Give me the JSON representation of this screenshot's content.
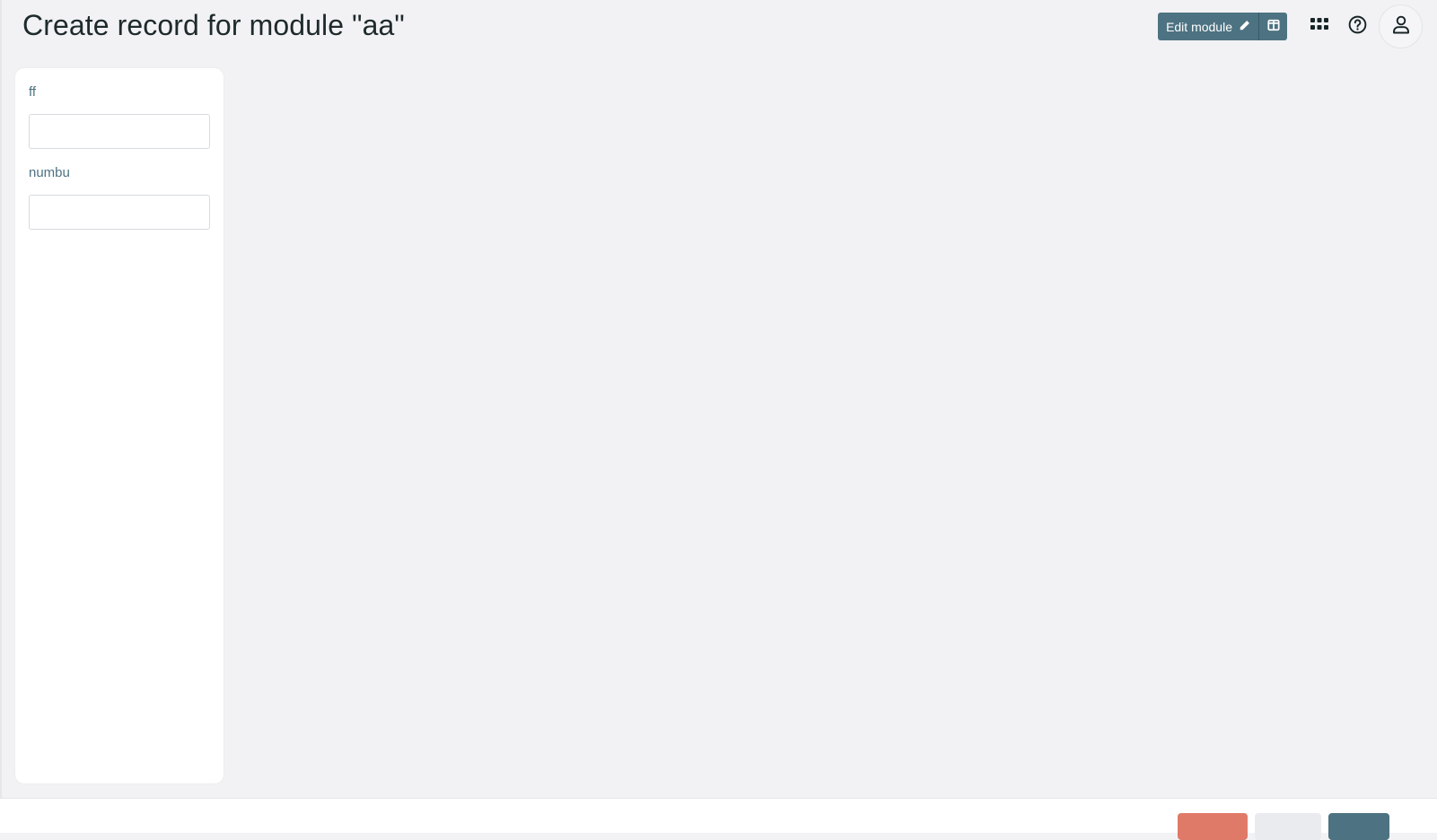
{
  "header": {
    "title": "Create record for module \"aa\"",
    "edit_module_label": "Edit module"
  },
  "icons": {
    "edit": "pencil-icon",
    "layout": "columns-icon",
    "apps": "grid-icon",
    "help": "help-circle-icon",
    "user": "user-icon"
  },
  "form": {
    "fields": [
      {
        "label": "ff",
        "value": ""
      },
      {
        "label": "numbu",
        "value": ""
      }
    ]
  },
  "colors": {
    "primary": "#4d7281",
    "danger": "#e07a68",
    "background": "#f2f2f5"
  }
}
